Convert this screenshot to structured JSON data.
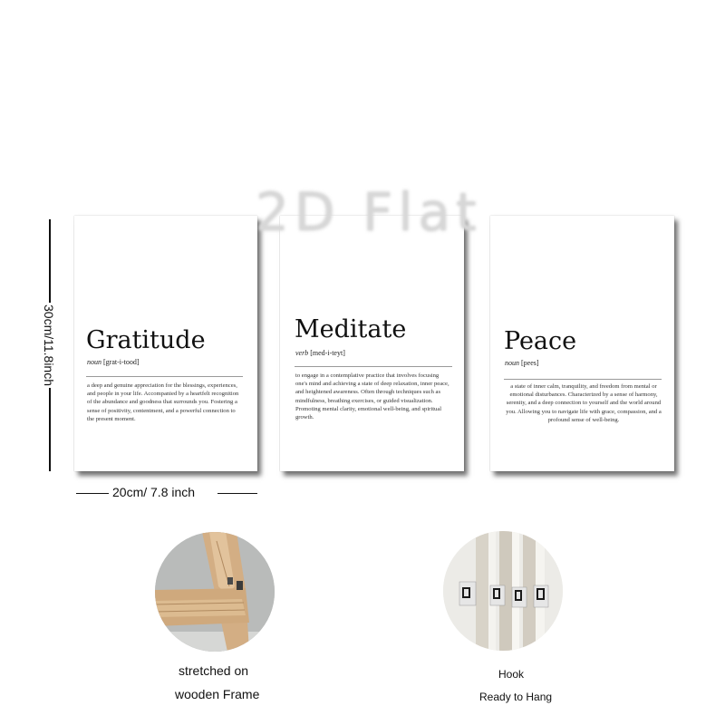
{
  "watermark": "2D Flat",
  "prints": [
    {
      "word": "Gratitude",
      "pos": "noun",
      "pronunciation": "[grat-i-tood]",
      "definition": "a deep and genuine appreciation for the blessings, experiences, and people in your life. Accompanied by a heartfelt recognition of the abundance and goodness that surrounds you. Fostering a sense of positivity, contentment, and a powerful connection to the present moment."
    },
    {
      "word": "Meditate",
      "pos": "verb",
      "pronunciation": "[med-i-teyt]",
      "definition": "to engage in a contemplative practice that involves focusing one's mind and achieving a state of deep relaxation, inner peace, and heightened awareness. Often through techniques such as mindfulness, breathing exercises, or guided visualization. Promoting mental clarity, emotional well-being, and spiritual growth."
    },
    {
      "word": "Peace",
      "pos": "noun",
      "pronunciation": "[pees]",
      "definition": "a state of inner calm, tranquility, and freedom from mental or emotional disturbances. Characterized by a sense of harmony, serenity, and a deep connection to yourself and the world around you. Allowing you to navigate life with grace, compassion, and a profound sense of well-being."
    }
  ],
  "dimensions": {
    "height_label": "30cm/11.8inch",
    "width_label": "20cm/ 7.8 inch"
  },
  "details": {
    "frame_caption_line1": "stretched on",
    "frame_caption_line2": "wooden Frame",
    "hook_caption": "Hook",
    "ready_caption": "Ready to Hang"
  }
}
